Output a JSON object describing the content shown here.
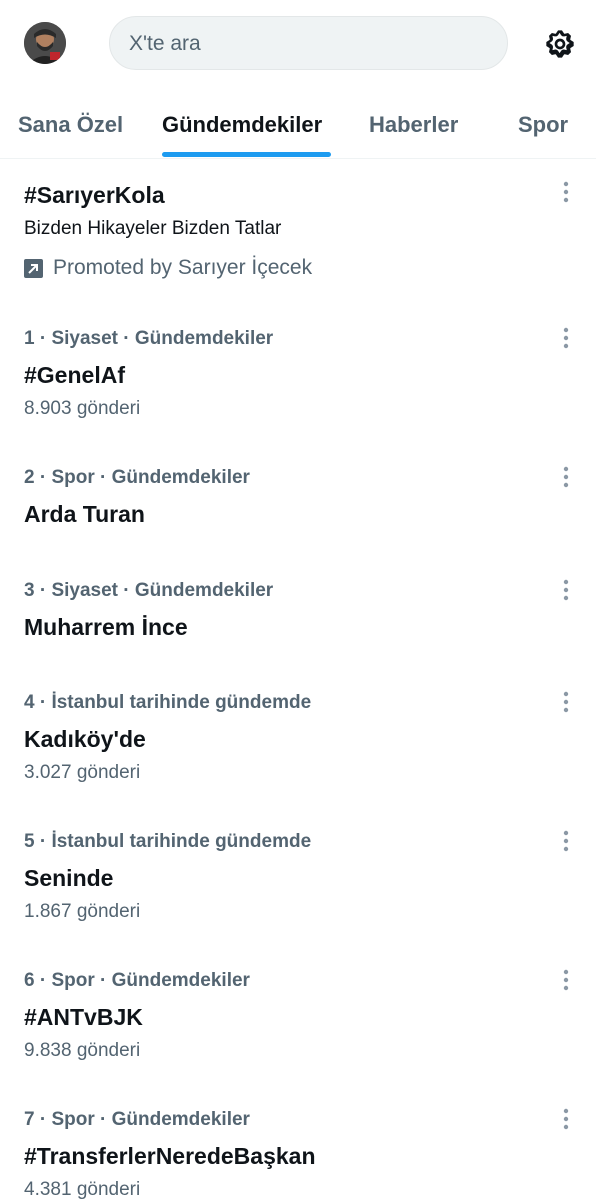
{
  "search": {
    "placeholder": "X'te ara"
  },
  "tabs": [
    {
      "label": "Sana Özel",
      "active": false
    },
    {
      "label": "Gündemdekiler",
      "active": true
    },
    {
      "label": "Haberler",
      "active": false
    },
    {
      "label": "Spor",
      "active": false
    }
  ],
  "accent_color": "#1d9bf0",
  "promoted": {
    "title": "#SarıyerKola",
    "description": "Bizden Hikayeler Bizden Tatlar",
    "promoted_by": "Promoted by Sarıyer İçecek"
  },
  "trends": [
    {
      "meta": "1 · Siyaset · Gündemdekiler",
      "title": "#GenelAf",
      "count": "8.903 gönderi"
    },
    {
      "meta": "2 · Spor · Gündemdekiler",
      "title": "Arda Turan",
      "count": ""
    },
    {
      "meta": "3 · Siyaset · Gündemdekiler",
      "title": "Muharrem İnce",
      "count": ""
    },
    {
      "meta": "4 · İstanbul tarihinde gündemde",
      "title": "Kadıköy'de",
      "count": "3.027 gönderi"
    },
    {
      "meta": "5 · İstanbul tarihinde gündemde",
      "title": "Seninde",
      "count": "1.867 gönderi"
    },
    {
      "meta": "6 · Spor · Gündemdekiler",
      "title": "#ANTvBJK",
      "count": "9.838 gönderi"
    },
    {
      "meta": "7 · Spor · Gündemdekiler",
      "title": "#TransferlerNeredeBaşkan",
      "count": "4.381 gönderi"
    }
  ]
}
